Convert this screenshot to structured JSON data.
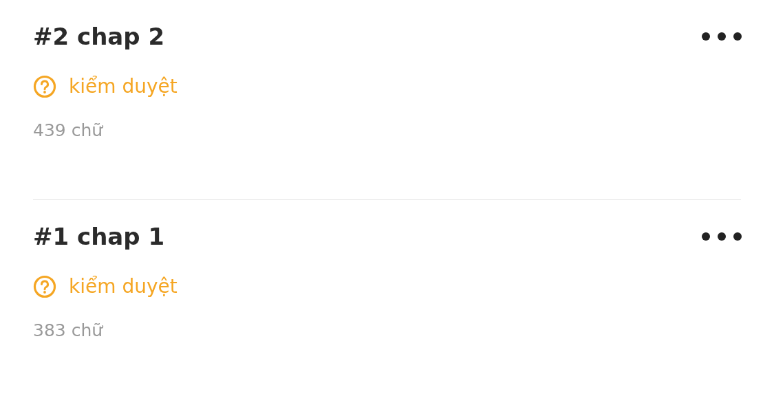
{
  "chapters": [
    {
      "title": "#2 chap 2",
      "status": {
        "kind": "review",
        "label": "kiểm duyệt"
      },
      "word_count": "439 chữ"
    },
    {
      "title": "#1 chap 1",
      "status": {
        "kind": "review",
        "label": "kiểm duyệt"
      },
      "word_count": "383 chữ"
    }
  ]
}
